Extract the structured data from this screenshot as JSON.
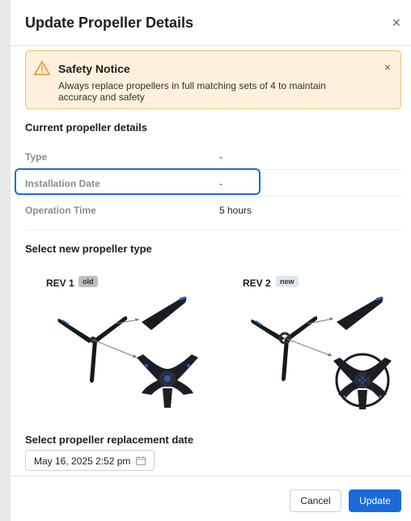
{
  "dialog": {
    "title": "Update Propeller Details"
  },
  "notice": {
    "title": "Safety Notice",
    "text": "Always replace propellers in full matching sets of 4 to maintain accuracy and safety"
  },
  "current": {
    "section_title": "Current propeller details",
    "rows": [
      {
        "label": "Type",
        "value": "-"
      },
      {
        "label": "Installation Date",
        "value": "-"
      },
      {
        "label": "Operation Time",
        "value": "5 hours"
      }
    ]
  },
  "selection": {
    "section_title": "Select new propeller type",
    "options": [
      {
        "label": "REV 1",
        "badge": "old"
      },
      {
        "label": "REV 2",
        "badge": "new"
      }
    ]
  },
  "date": {
    "section_title": "Select propeller replacement date",
    "value": "May 16, 2025 2:52 pm"
  },
  "footer": {
    "cancel_label": "Cancel",
    "update_label": "Update"
  },
  "colors": {
    "accent": "#1a6ad8",
    "notice_bg": "#fdf1dd",
    "notice_border": "#f5c37a",
    "warning_icon": "#e8a23a"
  },
  "icons": {
    "close": "close-icon",
    "warning": "warning-triangle-icon",
    "calendar": "calendar-icon"
  }
}
